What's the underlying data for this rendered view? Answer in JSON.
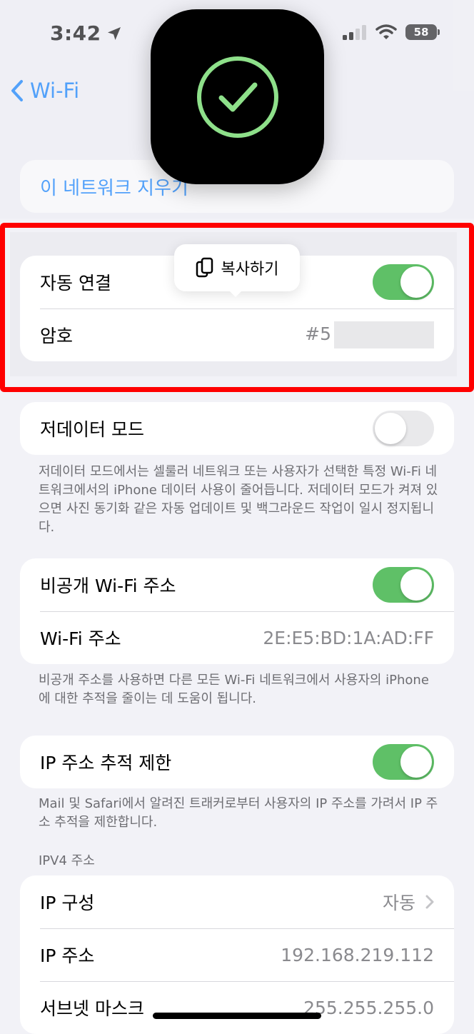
{
  "status_bar": {
    "time": "3:42",
    "battery": "58"
  },
  "nav": {
    "back_label": "Wi-Fi"
  },
  "forget": {
    "label": "이 네트워크 지우기"
  },
  "network": {
    "auto_join_label": "자동 연결",
    "password_label": "암호",
    "password_value": "#5"
  },
  "popover": {
    "copy_label": "복사하기"
  },
  "low_data": {
    "label": "저데이터 모드",
    "footer": "저데이터 모드에서는 셀룰러 네트워크 또는 사용자가 선택한 특정 Wi-Fi 네트워크에서의 iPhone 데이터 사용이 줄어듭니다. 저데이터 모드가 켜져 있으면 사진 동기화 같은 자동 업데이트 및 백그라운드 작업이 일시 정지됩니다."
  },
  "private_address": {
    "toggle_label": "비공개 Wi-Fi 주소",
    "address_label": "Wi-Fi 주소",
    "address_value": "2E:E5:BD:1A:AD:FF",
    "footer": "비공개 주소를 사용하면 다른 모든 Wi-Fi 네트워크에서 사용자의 iPhone에 대한 추적을 줄이는 데 도움이 됩니다."
  },
  "ip_tracking": {
    "label": "IP 주소 추적 제한",
    "footer": "Mail 및 Safari에서 알려진 트래커로부터 사용자의 IP 주소를 가려서 IP 주소 추적을 제한합니다."
  },
  "ipv4": {
    "header": "IPV4 주소",
    "config_label": "IP 구성",
    "config_value": "자동",
    "ip_label": "IP 주소",
    "ip_value": "192.168.219.112",
    "subnet_label": "서브넷 마스크",
    "subnet_value": "255.255.255.0"
  },
  "colors": {
    "accent": "#007aff",
    "toggle_on": "#5fc067",
    "highlight": "#ff0000",
    "hud_check": "#8ee08a"
  },
  "icons": [
    "location-arrow-icon",
    "signal-icon",
    "wifi-icon",
    "battery-icon",
    "chevron-left-icon",
    "checkmark-icon",
    "copy-icon",
    "chevron-right-icon"
  ],
  "toggles": {
    "auto_join": true,
    "low_data": false,
    "private_address": true,
    "ip_tracking": true
  }
}
